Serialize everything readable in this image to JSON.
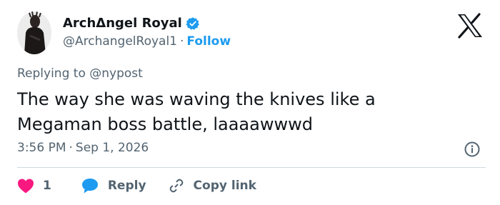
{
  "user": {
    "name": "ArchΔngel Royal",
    "handle": "@ArchangelRoyal1",
    "separator": "·",
    "follow_label": "Follow"
  },
  "tweet": {
    "reply_to": "Replying to @nypost",
    "text_line1": "The way she was waving the knives like a",
    "text_line2": "Megaman boss battle, laaaawwwd",
    "time": "3:56 PM",
    "meta_separator": "·",
    "date": "Sep 1, 2026"
  },
  "actions": {
    "like_count": "1",
    "reply_label": "Reply",
    "copy_label": "Copy link"
  },
  "icons": {
    "verified": "verified-badge-icon",
    "x_logo": "x-logo-icon",
    "info": "info-icon",
    "like": "heart-icon",
    "reply": "speech-bubble-icon",
    "copy": "link-icon"
  },
  "colors": {
    "accent": "#1d9bf0",
    "like": "#f91880",
    "text": "#0f1419",
    "secondary": "#536471",
    "divider": "#cfd9de"
  }
}
